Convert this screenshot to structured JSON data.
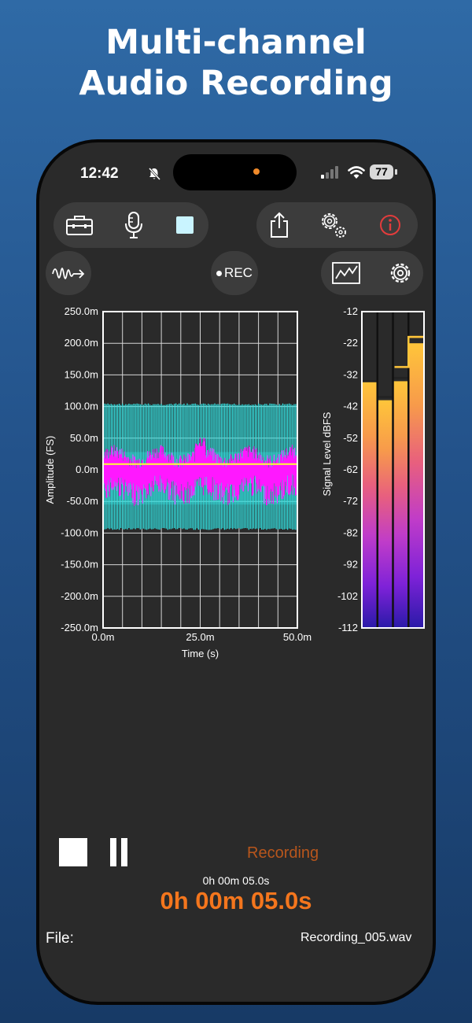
{
  "headline": {
    "line1": "Multi-channel",
    "line2": "Audio Recording"
  },
  "status_bar": {
    "time": "12:42",
    "battery": "77"
  },
  "toolbar": {
    "rec_label": "REC",
    "icons": [
      "toolbox-icon",
      "microphone-icon",
      "stop-square-icon",
      "share-icon",
      "settings-gears-icon",
      "info-icon",
      "waveform-export-icon",
      "graph-icon",
      "gear-icon"
    ]
  },
  "chart_data": [
    {
      "type": "line",
      "title": "",
      "xlabel": "Time (s)",
      "ylabel": "Amplitude (FS)",
      "xlim": [
        0,
        50
      ],
      "ylim": [
        -250,
        250
      ],
      "x_ticks": [
        "0.0m",
        "25.0m",
        "50.0m"
      ],
      "y_ticks": [
        "250.0m",
        "200.0m",
        "150.0m",
        "100.0m",
        "50.0m",
        "0.0m",
        "-50.0m",
        "-100.0m",
        "-150.0m",
        "-200.0m",
        "-250.0m"
      ],
      "grid": true,
      "series": [
        {
          "color": "#33e0e0",
          "values_range": [
            -95,
            105
          ]
        },
        {
          "color": "#ff18ff",
          "values_range": [
            -60,
            50
          ]
        },
        {
          "color": "#ffff33",
          "values_range": [
            8,
            10
          ]
        }
      ]
    },
    {
      "type": "bar",
      "title": "",
      "ylabel": "Signal Level dBFS",
      "ylim": [
        -112,
        -12
      ],
      "y_ticks": [
        "-12",
        "-22",
        "-32",
        "-42",
        "-52",
        "-62",
        "-72",
        "-82",
        "-92",
        "-102",
        "-112"
      ],
      "channels": [
        {
          "level": -34,
          "peak": -34
        },
        {
          "level": -40,
          "peak": -39
        },
        {
          "level": -34,
          "peak": -33
        },
        {
          "level": -22,
          "peak": -20
        }
      ]
    }
  ],
  "transport": {
    "status": "Recording",
    "elapsed_small": "0h 00m 05.0s",
    "elapsed_big": "0h 00m 05.0s"
  },
  "file": {
    "label": "File:",
    "name": "Recording_005.wav"
  },
  "colors": {
    "accent": "#f4761d",
    "status": "#b8561c",
    "ch1": "#33e0e0",
    "ch2": "#ff18ff",
    "ch3": "#ffff33",
    "panel": "#3c3c3c"
  }
}
